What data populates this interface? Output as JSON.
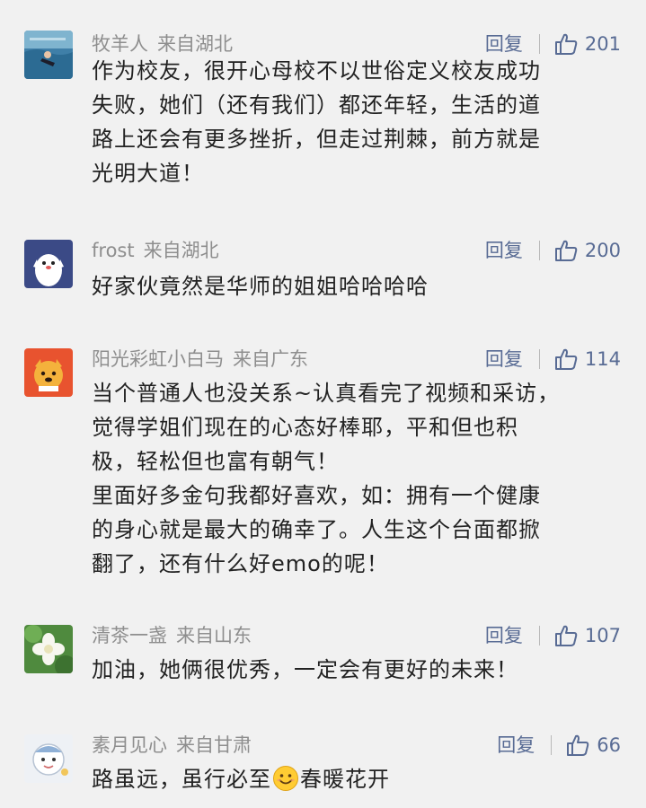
{
  "reply_label": "回复",
  "comments": [
    {
      "username": "牧羊人",
      "location": "来自湖北",
      "likes": "201",
      "avatar_icon": "swimmer-photo-icon",
      "lines": [
        "作为校友，很开心母校不以世俗定义校友成功",
        "失败，她们（还有我们）都还年轻，生活的道",
        "路上还会有更多挫折，但走过荆棘，前方就是",
        "光明大道！"
      ]
    },
    {
      "username": "frost",
      "location": "来自湖北",
      "likes": "200",
      "avatar_icon": "penguin-cartoon-icon",
      "lines": [
        "好家伙竟然是华师的姐姐哈哈哈哈"
      ]
    },
    {
      "username": "阳光彩虹小白马",
      "location": "来自广东",
      "likes": "114",
      "avatar_icon": "cartoon-dog-icon",
      "lines": [
        "当个普通人也没关系~认真看完了视频和采访，",
        "觉得学姐们现在的心态好棒耶，平和但也积",
        "极，轻松但也富有朝气！",
        "里面好多金句我都好喜欢，如：拥有一个健康",
        "的身心就是最大的确幸了。人生这个台面都掀",
        "翻了，还有什么好emo的呢！"
      ]
    },
    {
      "username": "清茶一盏",
      "location": "来自山东",
      "likes": "107",
      "avatar_icon": "white-flower-icon",
      "lines": [
        "加油，她俩很优秀，一定会有更好的未来！"
      ]
    },
    {
      "username": "素月见心",
      "location": "来自甘肃",
      "likes": "66",
      "avatar_icon": "cartoon-character-icon",
      "line_before_emoji": "路虽远，虽行必至",
      "emoji_icon": "smile-emoji-icon",
      "line_after_emoji": "春暖花开"
    }
  ]
}
